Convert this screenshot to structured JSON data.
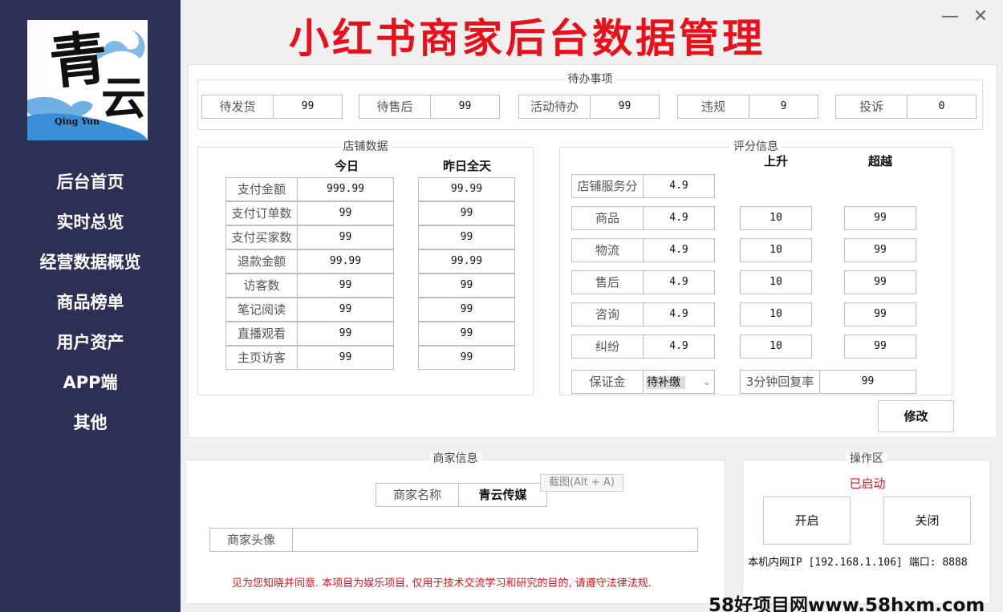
{
  "app_title": "小红书商家后台数据管理",
  "logo": {
    "char1": "青",
    "char2": "云",
    "en": "Qing Yun"
  },
  "nav": [
    "后台首页",
    "实时总览",
    "经营数据概览",
    "商品榜单",
    "用户资产",
    "APP端",
    "其他"
  ],
  "window": {
    "minimize": "—",
    "close": "✕"
  },
  "todo": {
    "title": "待办事项",
    "items": [
      {
        "label": "待发货",
        "value": "99"
      },
      {
        "label": "待售后",
        "value": "99"
      },
      {
        "label": "活动待办",
        "value": "99"
      },
      {
        "label": "违规",
        "value": "9"
      },
      {
        "label": "投诉",
        "value": "0"
      }
    ]
  },
  "store": {
    "title": "店铺数据",
    "col_today": "今日",
    "col_yesterday": "昨日全天",
    "rows": [
      {
        "label": "支付金额",
        "today": "999.99",
        "yesterday": "99.99"
      },
      {
        "label": "支付订单数",
        "today": "99",
        "yesterday": "99"
      },
      {
        "label": "支付买家数",
        "today": "99",
        "yesterday": "99"
      },
      {
        "label": "退款金额",
        "today": "99.99",
        "yesterday": "99.99"
      },
      {
        "label": "访客数",
        "today": "99",
        "yesterday": "99"
      },
      {
        "label": "笔记阅读",
        "today": "99",
        "yesterday": "99"
      },
      {
        "label": "直播观看",
        "today": "99",
        "yesterday": "99"
      },
      {
        "label": "主页访客",
        "today": "99",
        "yesterday": "99"
      }
    ]
  },
  "rating": {
    "title": "评分信息",
    "col_up": "上升",
    "col_beyond": "超越",
    "service_label": "店铺服务分",
    "service_value": "4.9",
    "rows": [
      {
        "label": "商品",
        "score": "4.9",
        "up": "10",
        "beyond": "99"
      },
      {
        "label": "物流",
        "score": "4.9",
        "up": "10",
        "beyond": "99"
      },
      {
        "label": "售后",
        "score": "4.9",
        "up": "10",
        "beyond": "99"
      },
      {
        "label": "咨询",
        "score": "4.9",
        "up": "10",
        "beyond": "99"
      },
      {
        "label": "纠纷",
        "score": "4.9",
        "up": "10",
        "beyond": "99"
      }
    ],
    "deposit_label": "保证金",
    "deposit_value": "待补缴",
    "reply_label": "3分钟回复率",
    "reply_value": "99",
    "modify_button": "修改"
  },
  "merchant": {
    "title": "商家信息",
    "name_label": "商家名称",
    "name_value": "青云传媒",
    "avatar_label": "商家头像",
    "avatar_value": "",
    "tooltip": "截图(Alt + A)",
    "disclaimer": "见为您知晓并同意. 本项目为娱乐项目, 仅用于技术交流学习和研究的目的, 请遵守法律法规."
  },
  "ops": {
    "title": "操作区",
    "status": "已启动",
    "start_button": "开启",
    "stop_button": "关闭",
    "network_info": "本机内网IP [192.168.1.106] 端口: 8888"
  },
  "watermark": "58好项目网www.58hxm.com",
  "colors": {
    "sidebar": "#2d2f55",
    "title_red": "#e8101b",
    "status_red": "#e8101b"
  }
}
